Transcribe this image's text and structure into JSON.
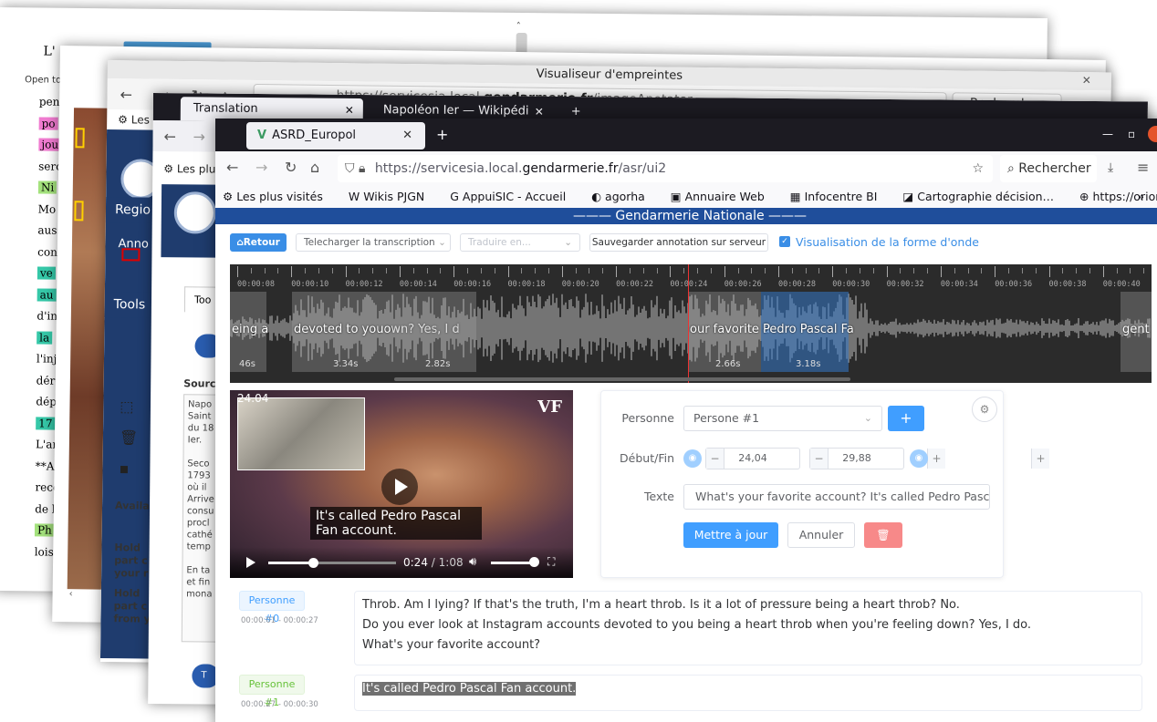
{
  "window_doc": {
    "heading": "L'",
    "open_to": "Open to",
    "lines": [
      {
        "text": "pen",
        "hl": ""
      },
      {
        "text": "po",
        "hl": "pink"
      },
      {
        "text": "jou",
        "hl": "pink"
      },
      {
        "text": "serc",
        "hl": ""
      },
      {
        "text": "Ni",
        "hl": "green"
      },
      {
        "text": "Mo",
        "hl": ""
      },
      {
        "text": "auss",
        "hl": ""
      },
      {
        "text": "con",
        "hl": ""
      },
      {
        "text": "ve",
        "hl": "teal"
      },
      {
        "text": "au",
        "hl": "teal"
      },
      {
        "text": "d'in",
        "hl": ""
      },
      {
        "text": "la",
        "hl": "teal"
      },
      {
        "text": "l'inj",
        "hl": ""
      },
      {
        "text": "déro",
        "hl": ""
      },
      {
        "text": "dép",
        "hl": ""
      },
      {
        "text": "17",
        "hl": "teal"
      },
      {
        "text": "L'ar",
        "hl": ""
      },
      {
        "text": "**A",
        "hl": ""
      },
      {
        "text": "reco",
        "hl": ""
      },
      {
        "text": "de l",
        "hl": ""
      },
      {
        "text": "Ph",
        "hl": "green"
      },
      {
        "text": "lois",
        "hl": ""
      }
    ]
  },
  "window_visualiseur": {
    "title": "Visualiseur d'empreintes",
    "url_prefix": "https://servicesia.local.",
    "url_domain": "gendarmerie.fr",
    "url_path": "/imageAnotator",
    "search": "Rechercher",
    "bookmarks": "Les plus",
    "anno": "Anno",
    "regions": "Regio",
    "tools": "Tools",
    "available": "Availa",
    "hold1": [
      "Hold",
      "part c",
      "your r"
    ],
    "hold2": [
      "Hold",
      "part c",
      "from y"
    ]
  },
  "window_translation": {
    "tabs": [
      {
        "label": "Translation"
      },
      {
        "label": "Napoléon Ier — Wikipédi"
      }
    ],
    "bookmarks": "Les plu",
    "tab_pane": "Too",
    "source_label": "Sourc",
    "source_text": [
      "Napo",
      "Saint",
      "du 18",
      "Ier.",
      "",
      "Seco",
      "1793",
      "où il",
      "Arrive",
      "consu",
      "procl",
      "cathé",
      "temp",
      "",
      "En ta",
      "et fin",
      "mona"
    ],
    "bottom_btn": "T"
  },
  "browser": {
    "tab_title": "ASRD_Europol",
    "url_prefix": "https://servicesia.local.",
    "url_domain": "gendarmerie.fr",
    "url_path": "/asr/ui2",
    "search": "Rechercher",
    "bookmarks": [
      "Les plus visités",
      "Wikis PJGN",
      "AppuiSIC - Accueil",
      "agorha",
      "Annuaire Web",
      "Infocentre BI",
      "Cartographie décision…",
      "https://orion.local.ge…"
    ]
  },
  "app": {
    "banner": "——— Gendarmerie Nationale ———",
    "retour": "Retour",
    "download": "Telecharger la transcription",
    "translate_placeholder": "Traduire en...",
    "save": "Sauvegarder annotation sur serveur",
    "waveform_label": "Visualisation de la forme d'onde",
    "timeline": [
      "00:00:08",
      "00:00:10",
      "00:00:12",
      "00:00:14",
      "00:00:16",
      "00:00:18",
      "00:00:20",
      "00:00:22",
      "00:00:24",
      "00:00:26",
      "00:00:28",
      "00:00:30",
      "00:00:32",
      "00:00:34",
      "00:00:36",
      "00:00:38",
      "00:00:40"
    ],
    "regions": [
      {
        "text": "eing a",
        "dur": "46s",
        "selected": false
      },
      {
        "text": "devoted to youown? Yes, I d",
        "dur": "3.34s",
        "selected": false
      },
      {
        "text": "",
        "dur": "2.82s",
        "selected": false
      },
      {
        "text": "our favorite a",
        "dur": "2.66s",
        "selected": false
      },
      {
        "text": "Pedro Pascal Fa",
        "dur": "3.18s",
        "selected": true
      },
      {
        "text": "gent a",
        "dur": "",
        "selected": false
      }
    ],
    "video": {
      "overlay_time": "24.04",
      "brand": "VF",
      "caption": "It's called Pedro Pascal Fan account.",
      "current": "0:24",
      "duration": "1:08",
      "progress": 0.353
    },
    "form": {
      "person_label": "Personne",
      "person_value": "Persone #1",
      "debut_fin_label": "Début/Fin",
      "start": "24,04",
      "end": "29,88",
      "texte_label": "Texte",
      "texte_value": "What's your favorite account? It's called Pedro Pascal Fan account.",
      "update": "Mettre à jour",
      "cancel": "Annuler"
    },
    "segments": [
      {
        "speaker": "Personne #0",
        "time": "00:00:01 - 00:00:27",
        "lines": [
          "Throb. Am I lying? If that's the truth, I'm a heart throb. Is it a lot of pressure being a heart throb? No.",
          "Do you ever look at Instagram accounts devoted to you being a heart throb when you're feeling down? Yes, I do.",
          "What's your favorite account?"
        ]
      },
      {
        "speaker": "Personne #1",
        "time": "00:00:27 - 00:00:30",
        "lines": [
          "It's called Pedro Pascal Fan account."
        ]
      }
    ]
  }
}
